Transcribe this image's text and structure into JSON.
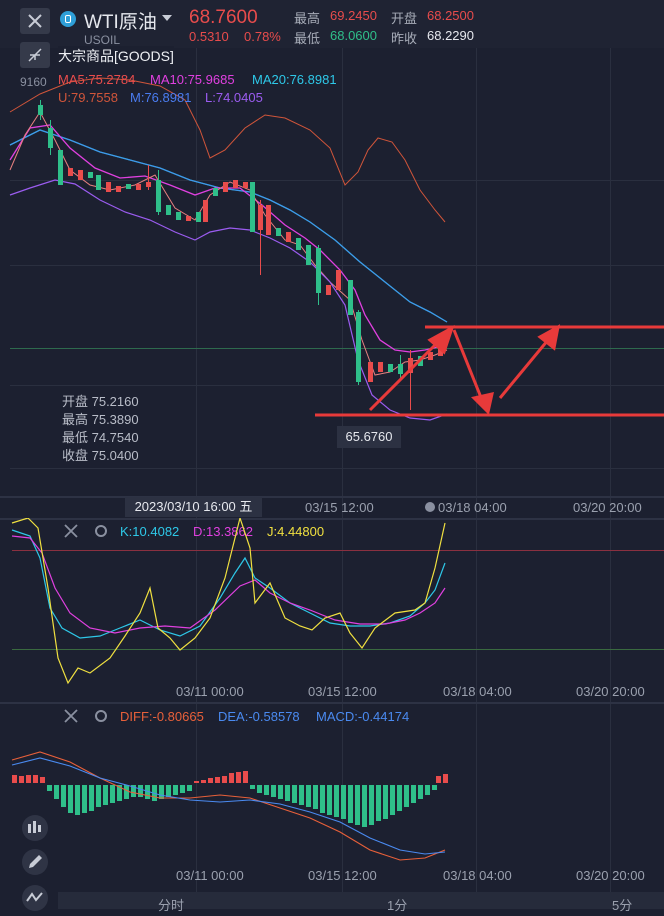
{
  "header": {
    "symbol_name": "WTI原油",
    "symbol_code": "USOIL",
    "price": "68.7600",
    "change": "0.5310",
    "change_pct": "0.78%",
    "high_label": "最高",
    "high": "69.2450",
    "open_label": "开盘",
    "open": "68.2500",
    "low_label": "最低",
    "low": "68.0600",
    "prev_label": "昨收",
    "prev": "68.2290",
    "category": "大宗商品[GOODS]",
    "axis_stub": "9160"
  },
  "main_indicators": {
    "ma5": "MA5:75.2784",
    "ma10": "MA10:75.9685",
    "ma20": "MA20:76.8981",
    "boll_u": "U:79.7558",
    "boll_m": "M:76.8981",
    "boll_l": "L:74.0405"
  },
  "ohlc_tooltip": {
    "open": "开盘 75.2160",
    "high": "最高 75.3890",
    "low": "最低 74.7540",
    "close": "收盘 75.0400"
  },
  "low_marker": "65.6760",
  "crosshair_date": "2023/03/10 16:00 五",
  "main_axis_ticks": [
    "03/15 12:00",
    "03/18 04:00",
    "03/20 20:00"
  ],
  "kdj": {
    "k": "K:10.4082",
    "d": "D:13.3862",
    "j": "J:4.44800"
  },
  "kdj_axis_ticks": [
    "03/11 00:00",
    "03/15 12:00",
    "03/18 04:00",
    "03/20 20:00"
  ],
  "macd": {
    "diff": "DIFF:-0.80665",
    "dea": "DEA:-0.58578",
    "macd": "MACD:-0.44174"
  },
  "macd_axis_ticks": [
    "03/11 00:00",
    "03/15 12:00",
    "03/18 04:00",
    "03/20 20:00"
  ],
  "bottom_tabs": [
    "分时",
    "1分",
    "5分"
  ],
  "colors": {
    "up": "#e84c4c",
    "down": "#2fbf8a",
    "ma5": "#e84c4c",
    "ma10": "#e040e0",
    "ma20": "#2ec8e8",
    "boll_u": "#d0553a",
    "boll_m": "#4a7cf0",
    "boll_l": "#9b5cf0",
    "k": "#2ec8e8",
    "d": "#e040e0",
    "j": "#f0e040",
    "diff": "#e8603a",
    "dea": "#4a8af0"
  }
}
